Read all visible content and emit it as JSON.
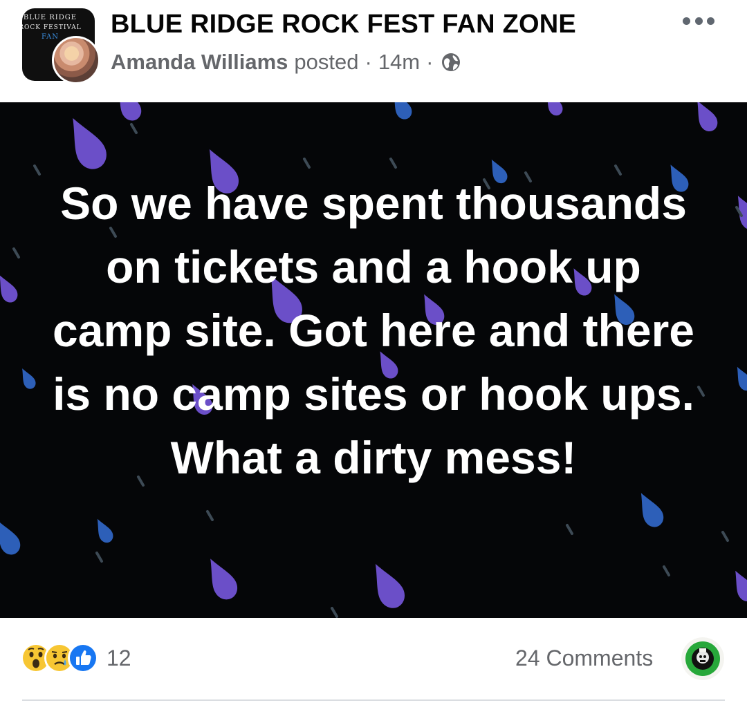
{
  "header": {
    "group_name": "BLUE RIDGE ROCK FEST FAN ZONE",
    "logo_text": [
      "BLUE RIDGE",
      "ROCK FESTIVAL",
      "FAN"
    ],
    "author": "Amanda Williams",
    "action": "posted",
    "separator": "·",
    "time": "14m",
    "privacy_icon": "globe-icon",
    "more_icon": "more-horizontal-icon"
  },
  "post": {
    "text": "So we have spent thousands on tickets and a hook up camp site. Got here and there is no camp sites or hook ups. What a dirty mess!",
    "background_color": "#050608",
    "raindrop_color": "#6b4fc8"
  },
  "footer": {
    "reactions": [
      "wow-icon",
      "sad-icon",
      "like-icon"
    ],
    "reaction_count": "12",
    "comments_label": "24 Comments"
  }
}
